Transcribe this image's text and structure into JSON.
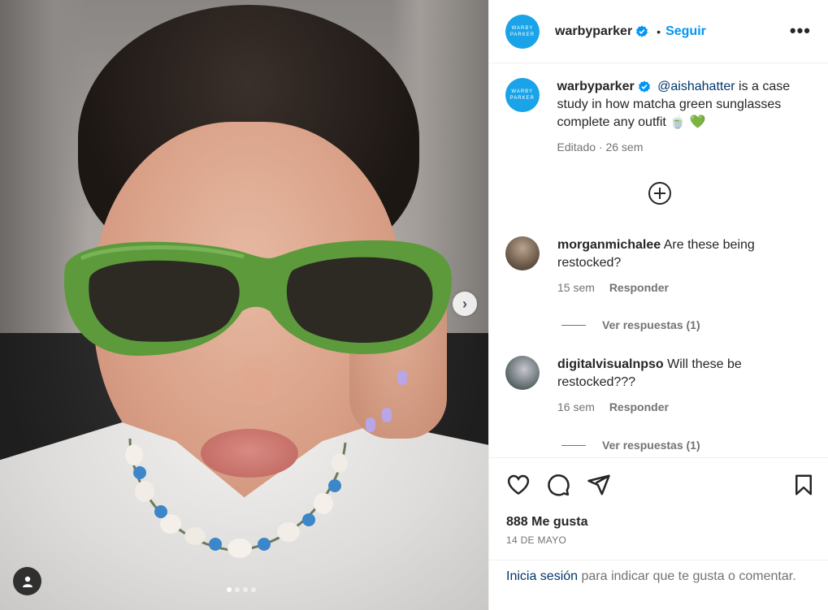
{
  "post": {
    "carousel": {
      "slide_count": 4,
      "active_index": 0
    },
    "next_label": "›"
  },
  "header": {
    "avatar_text_line1": "WARBY",
    "avatar_text_line2": "PARKER",
    "username": "warbyparker",
    "separator": "•",
    "follow_label": "Seguir",
    "more_label": "•••"
  },
  "caption": {
    "username": "warbyparker",
    "mention": "@aishahatter",
    "text": " is a case study in how matcha green sunglasses complete any outfit 🍵 💚",
    "meta": "Editado · 26 sem"
  },
  "comments": [
    {
      "username": "morganmichalee",
      "text": "Are these being restocked?",
      "age": "15 sem",
      "reply_label": "Responder",
      "view_replies": "Ver respuestas (1)"
    },
    {
      "username": "digitalvisualnpso",
      "text": "Will these be restocked???",
      "age": "16 sem",
      "reply_label": "Responder",
      "view_replies": "Ver respuestas (1)"
    }
  ],
  "stats": {
    "likes": "888 Me gusta",
    "date": "14 DE MAYO"
  },
  "login_prompt": {
    "link": "Inicia sesión",
    "rest": " para indicar que te gusta o comentar."
  },
  "colors": {
    "accent": "#0095f6",
    "brand_avatar": "#1aa3e8",
    "mention": "#00376b",
    "muted": "#737373",
    "glasses_frame": "#5d9a3c"
  },
  "icons": [
    "verified-badge-icon",
    "add-circle-icon",
    "heart-icon",
    "comment-icon",
    "share-icon",
    "bookmark-icon",
    "user-tag-icon",
    "chevron-right-icon"
  ]
}
